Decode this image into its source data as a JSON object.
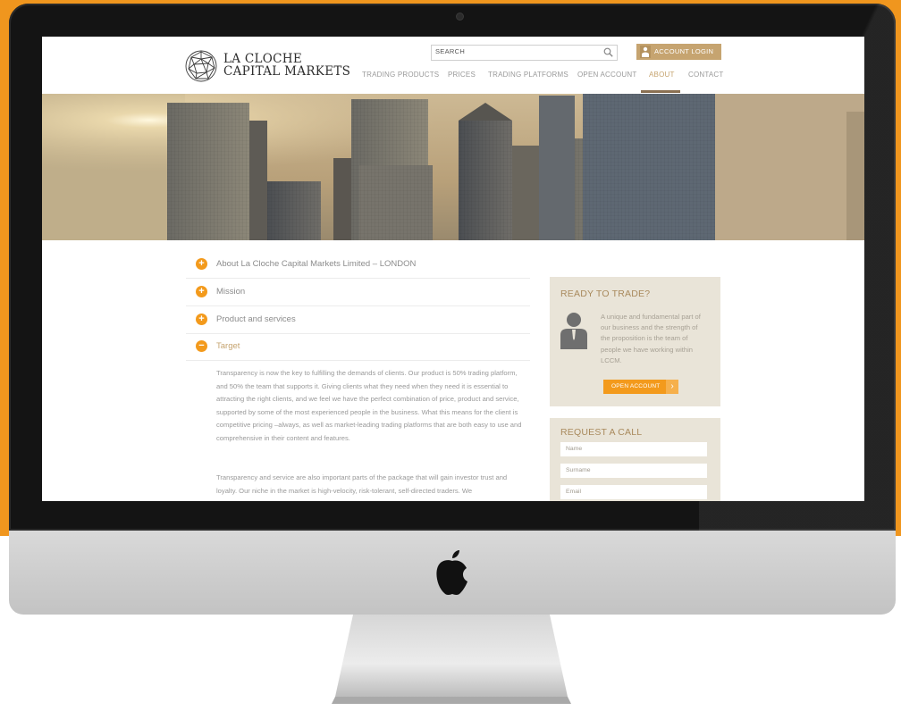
{
  "brand": {
    "line1": "LA CLOCHE",
    "line2": "CAPITAL MARKETS"
  },
  "header": {
    "search_label": "SEARCH",
    "account_login": "ACCOUNT LOGIN",
    "nav": [
      "TRADING PRODUCTS",
      "PRICES",
      "TRADING PLATFORMS",
      "OPEN ACCOUNT",
      "ABOUT",
      "CONTACT"
    ],
    "active_nav": "ABOUT"
  },
  "accordion": [
    {
      "label": "About La Cloche Capital Markets Limited – LONDON",
      "state": "+"
    },
    {
      "label": "Mission",
      "state": "+"
    },
    {
      "label": "Product and services",
      "state": "+"
    },
    {
      "label": "Target",
      "state": "−"
    }
  ],
  "target_text": {
    "para1": "Transparency is now the key to fulfilling the demands of clients. Our product is 50% trading platform, and 50% the team that supports it. Giving clients what they need when they need it is essential to attracting the right clients, and we feel we have the perfect combination of price, product and service, supported by some of the most experienced people in the business. What this means for the client is competitive pricing –always, as well as market-leading trading platforms that are both easy to use and comprehensive in their content and features.",
    "para2": "Transparency and service are also important parts of the package that will gain investor trust and loyalty. Our niche in the market is high-velocity, risk-tolerant, self-directed traders. We"
  },
  "sidebar": {
    "ready_title": "READY TO TRADE?",
    "ready_text": "A unique and fundamental part of our business and the strength of the proposition is the team of people we have working within LCCM.",
    "open_account_button": "OPEN ACCOUNT",
    "request_title": "REQUEST A CALL",
    "fields": {
      "name_placeholder": "Name",
      "surname_placeholder": "Surname",
      "email_placeholder": "Email"
    }
  },
  "colors": {
    "accent_gold": "#c6a470",
    "accent_orange": "#f39a1c",
    "panel_beige": "#e9e4d8",
    "backdrop_orange": "#f0961e"
  }
}
